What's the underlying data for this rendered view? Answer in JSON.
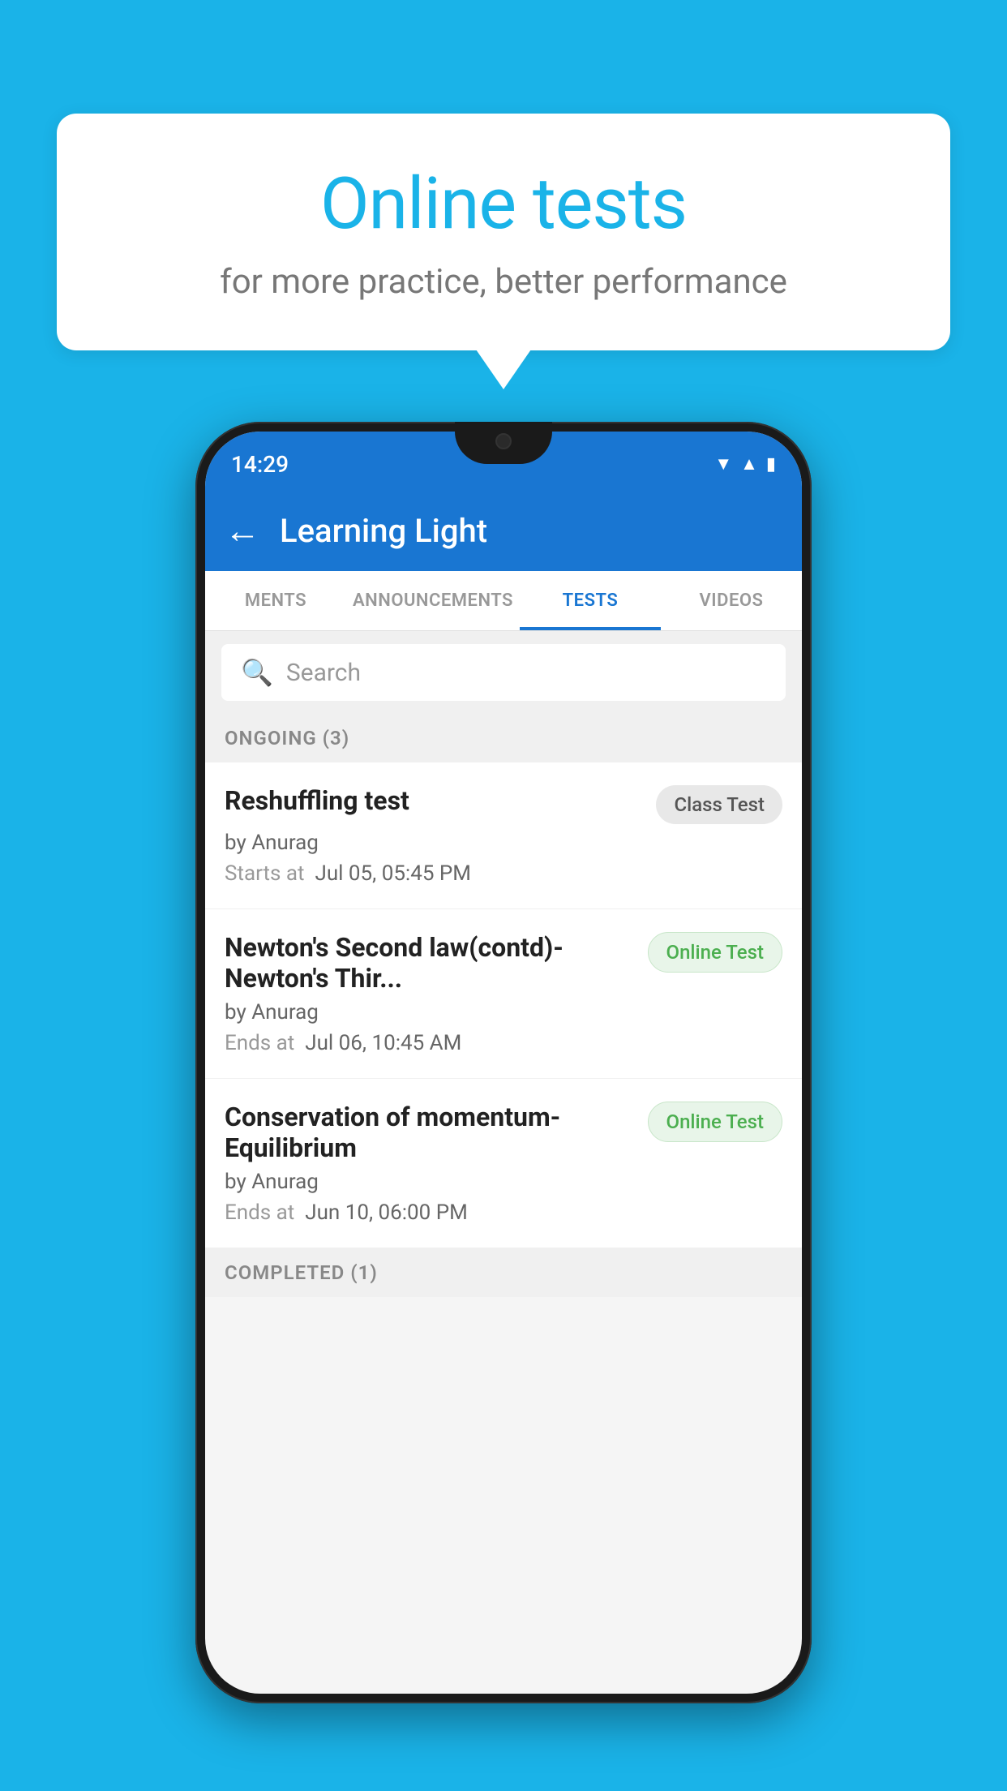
{
  "background_color": "#1ab3e8",
  "speech_bubble": {
    "title": "Online tests",
    "subtitle": "for more practice, better performance"
  },
  "phone": {
    "status_bar": {
      "time": "14:29",
      "icons": [
        "wifi",
        "signal",
        "battery"
      ]
    },
    "app_bar": {
      "title": "Learning Light",
      "back_label": "←"
    },
    "tabs": [
      {
        "label": "MENTS",
        "active": false
      },
      {
        "label": "ANNOUNCEMENTS",
        "active": false
      },
      {
        "label": "TESTS",
        "active": true
      },
      {
        "label": "VIDEOS",
        "active": false
      }
    ],
    "search": {
      "placeholder": "Search"
    },
    "sections": [
      {
        "title": "ONGOING (3)",
        "items": [
          {
            "name": "Reshuffling test",
            "badge": "Class Test",
            "badge_type": "class",
            "author": "by Anurag",
            "date_label": "Starts at",
            "date": "Jul 05, 05:45 PM"
          },
          {
            "name": "Newton's Second law(contd)-Newton's Thir...",
            "badge": "Online Test",
            "badge_type": "online",
            "author": "by Anurag",
            "date_label": "Ends at",
            "date": "Jul 06, 10:45 AM"
          },
          {
            "name": "Conservation of momentum-Equilibrium",
            "badge": "Online Test",
            "badge_type": "online",
            "author": "by Anurag",
            "date_label": "Ends at",
            "date": "Jun 10, 06:00 PM"
          }
        ]
      },
      {
        "title": "COMPLETED (1)",
        "items": []
      }
    ]
  }
}
